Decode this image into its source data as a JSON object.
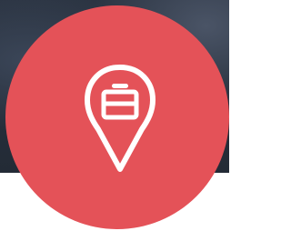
{
  "badge": {
    "icon": "location-pin-briefcase-icon",
    "background_color": "#e45258",
    "icon_color": "#ffffff"
  },
  "background": {
    "description_color": "#2b3442"
  }
}
